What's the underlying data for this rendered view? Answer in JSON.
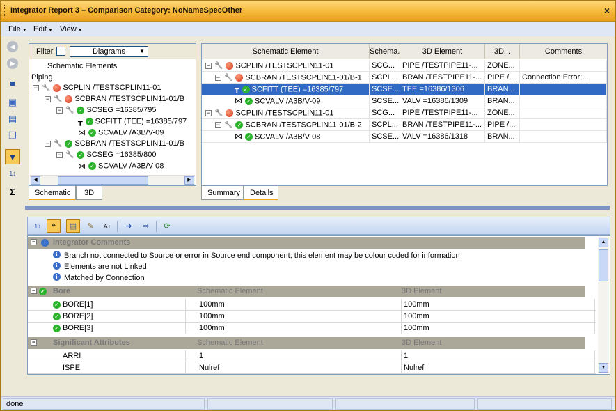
{
  "window": {
    "title": "Integrator Report 3 – Comparison Category: NoNameSpecOther",
    "close": "×"
  },
  "menu": [
    {
      "label": "File"
    },
    {
      "label": "Edit"
    },
    {
      "label": "View"
    }
  ],
  "left_panel": {
    "filter_label": "Filter",
    "diagram_select": "Diagrams",
    "header": "Schematic Elements",
    "group": "Piping",
    "tree": [
      {
        "level": 0,
        "exp": "−",
        "status": "red",
        "icon": "pipe",
        "text": "SCPLIN /TESTSCPLIN11-01"
      },
      {
        "level": 1,
        "exp": "−",
        "status": "red",
        "icon": "pipe",
        "text": "SCBRAN /TESTSCPLIN11-01/B"
      },
      {
        "level": 2,
        "exp": "−",
        "status": "green",
        "icon": "pipe",
        "text": "SCSEG =16385/795"
      },
      {
        "level": 3,
        "exp": "",
        "status": "green",
        "icon": "tee",
        "text": "SCFITT (TEE) =16385/797"
      },
      {
        "level": 3,
        "exp": "",
        "status": "green",
        "icon": "valve",
        "text": "SCVALV /A3B/V-09"
      },
      {
        "level": 1,
        "exp": "−",
        "status": "green",
        "icon": "pipe",
        "text": "SCBRAN /TESTSCPLIN11-01/B"
      },
      {
        "level": 2,
        "exp": "−",
        "status": "green",
        "icon": "pipe",
        "text": "SCSEG =16385/800"
      },
      {
        "level": 3,
        "exp": "",
        "status": "green",
        "icon": "valve",
        "text": "SCVALV /A3B/V-08"
      }
    ],
    "tabs": [
      {
        "label": "Schematic"
      },
      {
        "label": "3D"
      }
    ]
  },
  "grid": {
    "columns": [
      "Schematic Element",
      "Schema...",
      "3D Element",
      "3D...",
      "Comments"
    ],
    "rows": [
      {
        "level": 0,
        "exp": "−",
        "status": "red",
        "icon": "pipe",
        "c0": "SCPLIN /TESTSCPLIN11-01",
        "c1": "SCG...",
        "c2": "PIPE /TESTPIPE11-...",
        "c3": "ZONE...",
        "c4": "",
        "selected": false
      },
      {
        "level": 1,
        "exp": "−",
        "status": "red",
        "icon": "pipe",
        "c0": "SCBRAN /TESTSCPLIN11-01/B-1",
        "c1": "SCPL...",
        "c2": "BRAN /TESTPIPE11-...",
        "c3": "PIPE /...",
        "c4": "Connection Error;...",
        "selected": false
      },
      {
        "level": 2,
        "exp": "",
        "status": "green",
        "icon": "tee",
        "c0": "SCFITT (TEE) =16385/797",
        "c1": "SCSE...",
        "c2": "TEE =16386/1306",
        "c3": "BRAN...",
        "c4": "",
        "selected": true
      },
      {
        "level": 2,
        "exp": "",
        "status": "green",
        "icon": "valve",
        "c0": "SCVALV /A3B/V-09",
        "c1": "SCSE...",
        "c2": "VALV =16386/1309",
        "c3": "BRAN...",
        "c4": "",
        "selected": false
      },
      {
        "level": 0,
        "exp": "−",
        "status": "red",
        "icon": "pipe",
        "c0": "SCPLIN /TESTSCPLIN11-01",
        "c1": "SCG...",
        "c2": "PIPE /TESTPIPE11-...",
        "c3": "ZONE...",
        "c4": "",
        "selected": false
      },
      {
        "level": 1,
        "exp": "−",
        "status": "green",
        "icon": "pipe",
        "c0": "SCBRAN /TESTSCPLIN11-01/B-2",
        "c1": "SCPL...",
        "c2": "BRAN /TESTPIPE11-...",
        "c3": "PIPE /...",
        "c4": "",
        "selected": false
      },
      {
        "level": 2,
        "exp": "",
        "status": "green",
        "icon": "valve",
        "c0": "SCVALV /A3B/V-08",
        "c1": "SCSE...",
        "c2": "VALV =16386/1318",
        "c3": "BRAN...",
        "c4": "",
        "selected": false
      }
    ],
    "tabs": [
      {
        "label": "Summary"
      },
      {
        "label": "Details"
      }
    ]
  },
  "details": {
    "categories": {
      "comments": "Integrator Comments",
      "bore": "Bore",
      "attrs": "Significant Attributes",
      "col_schematic": "Schematic Element",
      "col_3d": "3D Element"
    },
    "comments": [
      "Branch not connected to Source or error in Source end component; this element may be colour coded for information",
      "Elements are not Linked",
      "Matched by Connection"
    ],
    "bore_rows": [
      {
        "name": "BORE[1]",
        "schematic": "100mm",
        "3d": "100mm"
      },
      {
        "name": "BORE[2]",
        "schematic": "100mm",
        "3d": "100mm"
      },
      {
        "name": "BORE[3]",
        "schematic": "100mm",
        "3d": "100mm"
      }
    ],
    "attr_rows": [
      {
        "name": "ARRI",
        "schematic": "1",
        "3d": "1"
      },
      {
        "name": "ISPE",
        "schematic": "Nulref",
        "3d": "Nulref"
      }
    ]
  },
  "status": {
    "text": "done"
  },
  "colors": {
    "title_bar": "#f6b93a",
    "selection": "#316ac5",
    "active_tab": "#f0a91a"
  }
}
